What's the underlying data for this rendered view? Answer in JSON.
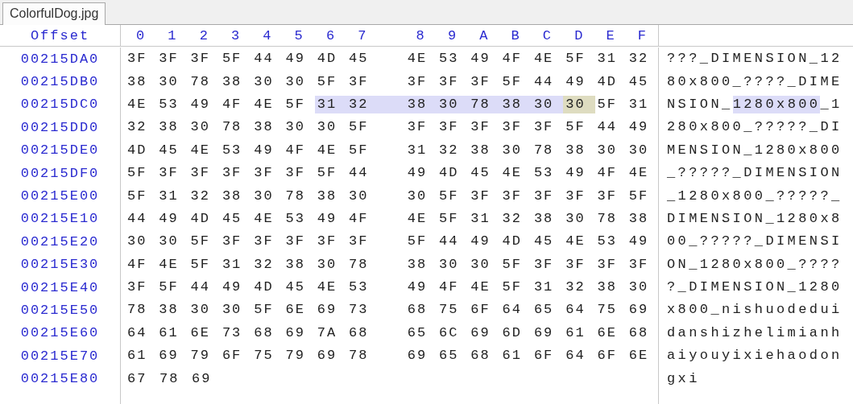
{
  "tabs": [
    {
      "label": "ColorfulDog.jpg",
      "selected": true
    }
  ],
  "header": {
    "offset": "Offset",
    "columns": [
      "0",
      "1",
      "2",
      "3",
      "4",
      "5",
      "6",
      "7",
      "8",
      "9",
      "A",
      "B",
      "C",
      "D",
      "E",
      "F"
    ]
  },
  "rows": [
    {
      "offset": "00215DA0",
      "hex": [
        {
          "bytes": [
            "3F",
            "3F",
            "3F",
            "5F",
            "44",
            "49",
            "4D",
            "45",
            "4E",
            "53",
            "49",
            "4F",
            "4E",
            "5F",
            "31",
            "32"
          ],
          "selected": false,
          "cursor": false
        }
      ],
      "ascii": [
        {
          "text": "???_DIMENSION_12",
          "selected": false
        }
      ]
    },
    {
      "offset": "00215DB0",
      "hex": [
        {
          "bytes": [
            "38",
            "30",
            "78",
            "38",
            "30",
            "30",
            "5F",
            "3F",
            "3F",
            "3F",
            "3F",
            "5F",
            "44",
            "49",
            "4D",
            "45"
          ],
          "selected": false,
          "cursor": false
        }
      ],
      "ascii": [
        {
          "text": "80x800_????_DIME",
          "selected": false
        }
      ]
    },
    {
      "offset": "00215DC0",
      "hex": [
        {
          "bytes": [
            "4E",
            "53",
            "49",
            "4F",
            "4E",
            "5F"
          ],
          "selected": false,
          "cursor": false
        },
        {
          "bytes": [
            "31",
            "32",
            "38",
            "30",
            "78",
            "38",
            "30"
          ],
          "selected": true,
          "cursor": false
        },
        {
          "bytes": [
            "30"
          ],
          "selected": false,
          "cursor": true
        },
        {
          "bytes": [
            "5F",
            "31"
          ],
          "selected": false,
          "cursor": false
        }
      ],
      "ascii": [
        {
          "text": "NSION_",
          "selected": false
        },
        {
          "text": "1280x800",
          "selected": true
        },
        {
          "text": "_1",
          "selected": false
        }
      ]
    },
    {
      "offset": "00215DD0",
      "hex": [
        {
          "bytes": [
            "32",
            "38",
            "30",
            "78",
            "38",
            "30",
            "30",
            "5F",
            "3F",
            "3F",
            "3F",
            "3F",
            "3F",
            "5F",
            "44",
            "49"
          ],
          "selected": false,
          "cursor": false
        }
      ],
      "ascii": [
        {
          "text": "280x800_?????_DI",
          "selected": false
        }
      ]
    },
    {
      "offset": "00215DE0",
      "hex": [
        {
          "bytes": [
            "4D",
            "45",
            "4E",
            "53",
            "49",
            "4F",
            "4E",
            "5F",
            "31",
            "32",
            "38",
            "30",
            "78",
            "38",
            "30",
            "30"
          ],
          "selected": false,
          "cursor": false
        }
      ],
      "ascii": [
        {
          "text": "MENSION_1280x800",
          "selected": false
        }
      ]
    },
    {
      "offset": "00215DF0",
      "hex": [
        {
          "bytes": [
            "5F",
            "3F",
            "3F",
            "3F",
            "3F",
            "3F",
            "5F",
            "44",
            "49",
            "4D",
            "45",
            "4E",
            "53",
            "49",
            "4F",
            "4E"
          ],
          "selected": false,
          "cursor": false
        }
      ],
      "ascii": [
        {
          "text": "_?????_DIMENSION",
          "selected": false
        }
      ]
    },
    {
      "offset": "00215E00",
      "hex": [
        {
          "bytes": [
            "5F",
            "31",
            "32",
            "38",
            "30",
            "78",
            "38",
            "30",
            "30",
            "5F",
            "3F",
            "3F",
            "3F",
            "3F",
            "3F",
            "5F"
          ],
          "selected": false,
          "cursor": false
        }
      ],
      "ascii": [
        {
          "text": "_1280x800_?????_",
          "selected": false
        }
      ]
    },
    {
      "offset": "00215E10",
      "hex": [
        {
          "bytes": [
            "44",
            "49",
            "4D",
            "45",
            "4E",
            "53",
            "49",
            "4F",
            "4E",
            "5F",
            "31",
            "32",
            "38",
            "30",
            "78",
            "38"
          ],
          "selected": false,
          "cursor": false
        }
      ],
      "ascii": [
        {
          "text": "DIMENSION_1280x8",
          "selected": false
        }
      ]
    },
    {
      "offset": "00215E20",
      "hex": [
        {
          "bytes": [
            "30",
            "30",
            "5F",
            "3F",
            "3F",
            "3F",
            "3F",
            "3F",
            "5F",
            "44",
            "49",
            "4D",
            "45",
            "4E",
            "53",
            "49"
          ],
          "selected": false,
          "cursor": false
        }
      ],
      "ascii": [
        {
          "text": "00_?????_DIMENSI",
          "selected": false
        }
      ]
    },
    {
      "offset": "00215E30",
      "hex": [
        {
          "bytes": [
            "4F",
            "4E",
            "5F",
            "31",
            "32",
            "38",
            "30",
            "78",
            "38",
            "30",
            "30",
            "5F",
            "3F",
            "3F",
            "3F",
            "3F"
          ],
          "selected": false,
          "cursor": false
        }
      ],
      "ascii": [
        {
          "text": "ON_1280x800_????",
          "selected": false
        }
      ]
    },
    {
      "offset": "00215E40",
      "hex": [
        {
          "bytes": [
            "3F",
            "5F",
            "44",
            "49",
            "4D",
            "45",
            "4E",
            "53",
            "49",
            "4F",
            "4E",
            "5F",
            "31",
            "32",
            "38",
            "30"
          ],
          "selected": false,
          "cursor": false
        }
      ],
      "ascii": [
        {
          "text": "?_DIMENSION_1280",
          "selected": false
        }
      ]
    },
    {
      "offset": "00215E50",
      "hex": [
        {
          "bytes": [
            "78",
            "38",
            "30",
            "30",
            "5F",
            "6E",
            "69",
            "73",
            "68",
            "75",
            "6F",
            "64",
            "65",
            "64",
            "75",
            "69"
          ],
          "selected": false,
          "cursor": false
        }
      ],
      "ascii": [
        {
          "text": "x800_nishuodedui",
          "selected": false
        }
      ]
    },
    {
      "offset": "00215E60",
      "hex": [
        {
          "bytes": [
            "64",
            "61",
            "6E",
            "73",
            "68",
            "69",
            "7A",
            "68",
            "65",
            "6C",
            "69",
            "6D",
            "69",
            "61",
            "6E",
            "68"
          ],
          "selected": false,
          "cursor": false
        }
      ],
      "ascii": [
        {
          "text": "danshizhelimianh",
          "selected": false
        }
      ]
    },
    {
      "offset": "00215E70",
      "hex": [
        {
          "bytes": [
            "61",
            "69",
            "79",
            "6F",
            "75",
            "79",
            "69",
            "78",
            "69",
            "65",
            "68",
            "61",
            "6F",
            "64",
            "6F",
            "6E"
          ],
          "selected": false,
          "cursor": false
        }
      ],
      "ascii": [
        {
          "text": "aiyouyixiehaodon",
          "selected": false
        }
      ]
    },
    {
      "offset": "00215E80",
      "hex": [
        {
          "bytes": [
            "67",
            "78",
            "69"
          ],
          "selected": false,
          "cursor": false
        }
      ],
      "ascii": [
        {
          "text": "gxi",
          "selected": false
        }
      ]
    }
  ]
}
